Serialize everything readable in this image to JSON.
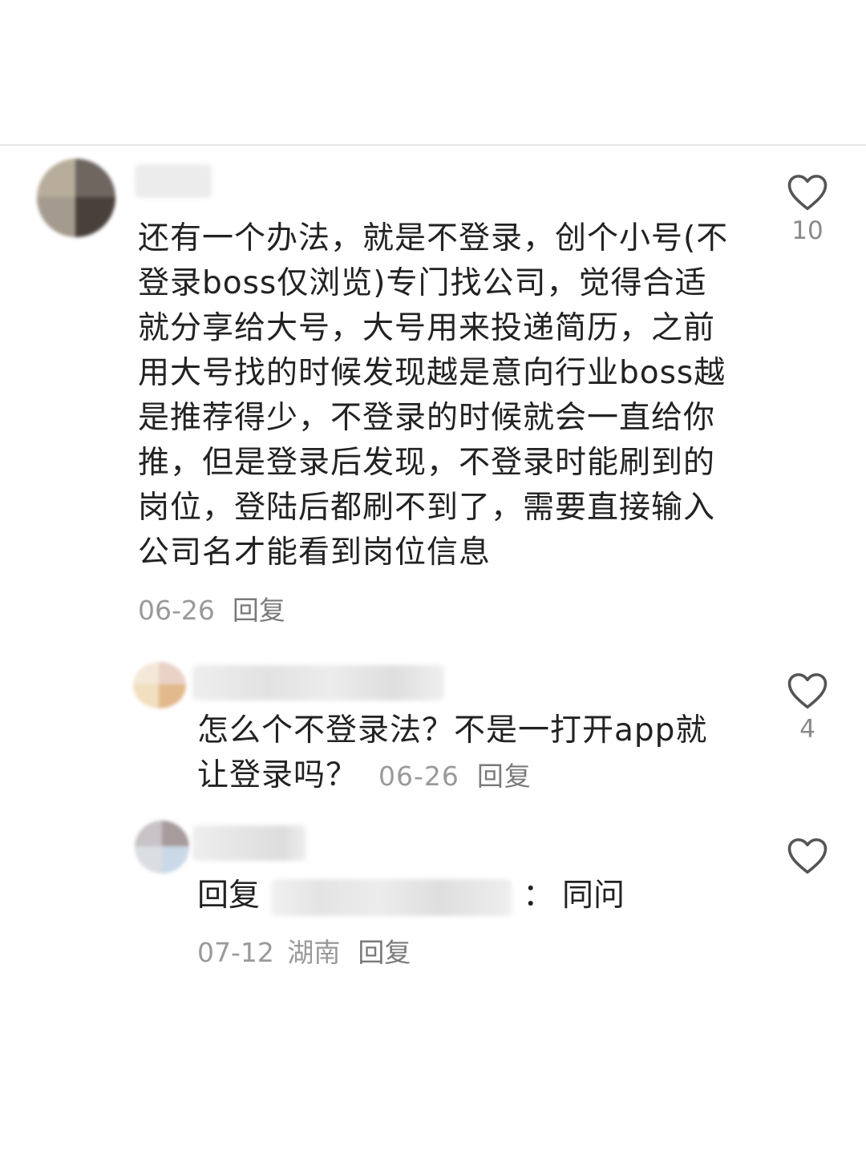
{
  "comments": [
    {
      "text": "还有一个办法，就是不登录，创个小号(不登录boss仅浏览)专门找公司，觉得合适就分享给大号，大号用来投递简历，之前用大号找的时候发现越是意向行业boss越是推荐得少，不登录的时候就会一直给你推，但是登录后发现，不登录时能刷到的岗位，登陆后都刷不到了，需要直接输入公司名才能看到岗位信息",
      "date": "06-26",
      "reply_label": "回复",
      "likes": "10"
    },
    {
      "text": "怎么个不登录法？不是一打开app就让登录吗？",
      "date": "06-26",
      "reply_label": "回复",
      "likes": "4"
    },
    {
      "reply_prefix": "回复",
      "separator": "：",
      "text": "同问",
      "date": "07-12",
      "location": "湖南",
      "reply_label": "回复",
      "likes": ""
    }
  ],
  "icons": {
    "like": "heart-outline-icon"
  },
  "colors": {
    "text": "#222222",
    "meta": "#9a9a9a",
    "icon": "#555555",
    "divider": "#e6e6e6"
  }
}
